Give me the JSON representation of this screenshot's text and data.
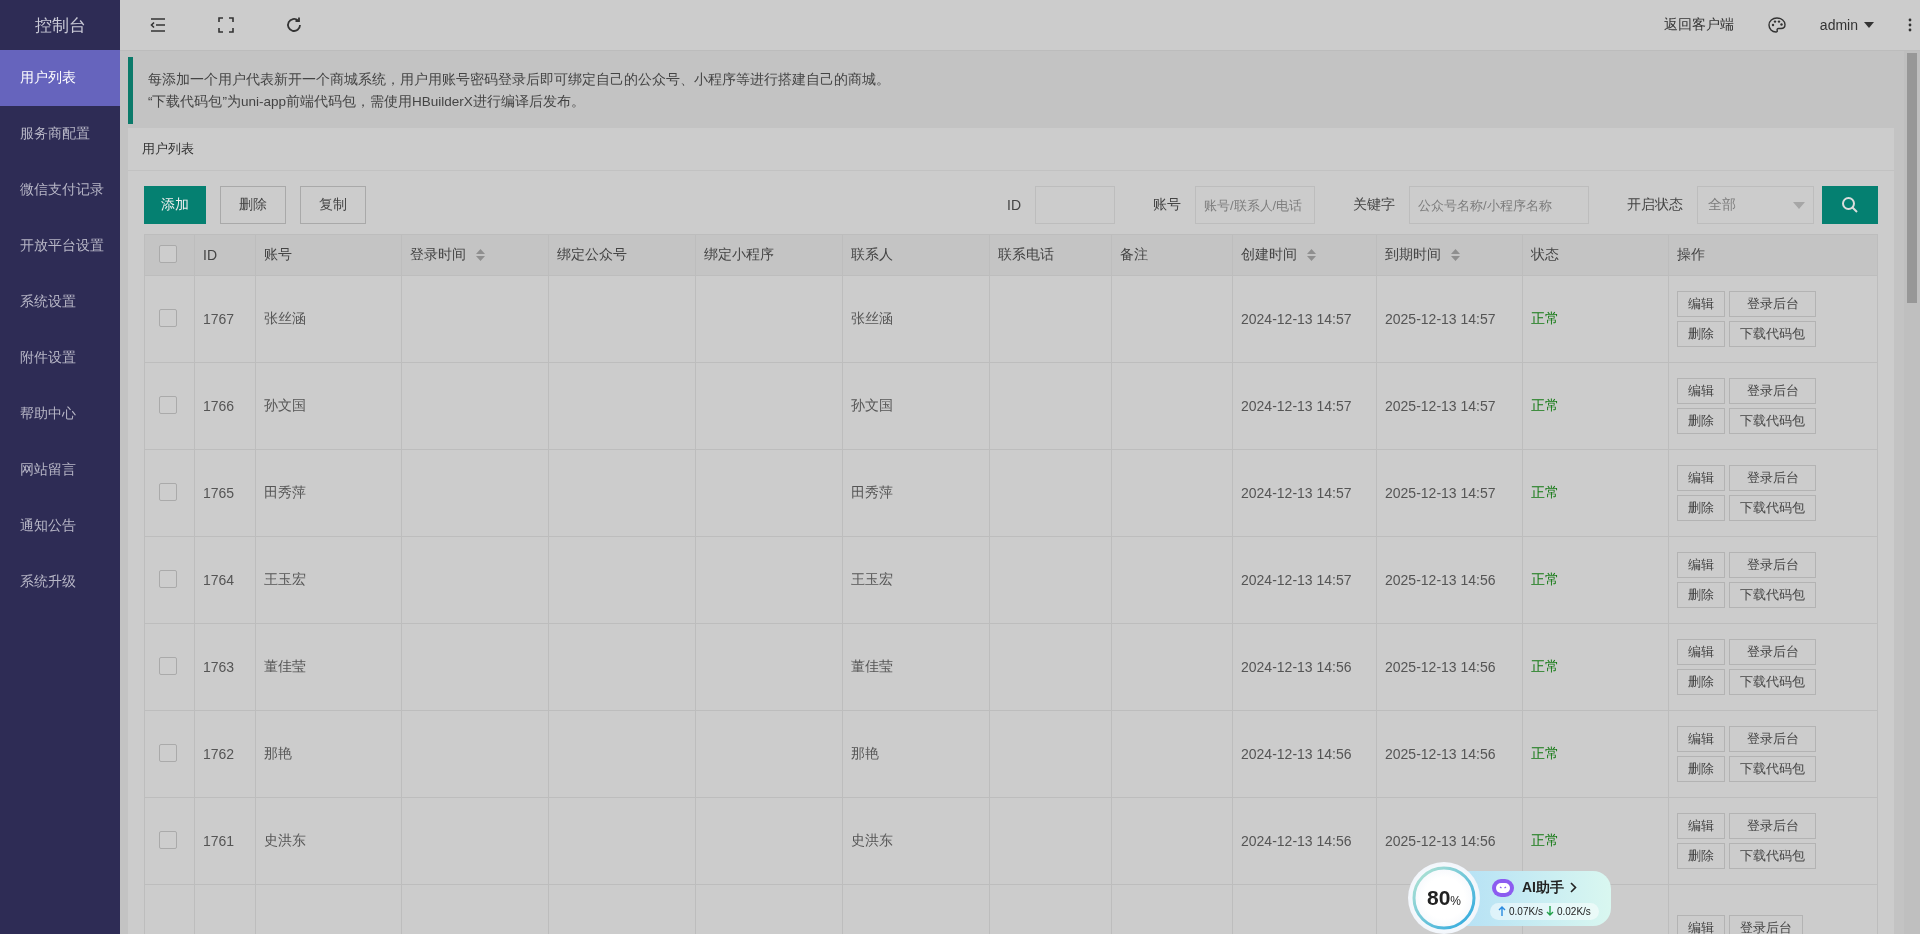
{
  "sidebar": {
    "title": "控制台",
    "items": [
      {
        "label": "用户列表",
        "selected": true
      },
      {
        "label": "服务商配置",
        "selected": false
      },
      {
        "label": "微信支付记录",
        "selected": false
      },
      {
        "label": "开放平台设置",
        "selected": false
      },
      {
        "label": "系统设置",
        "selected": false
      },
      {
        "label": "附件设置",
        "selected": false
      },
      {
        "label": "帮助中心",
        "selected": false
      },
      {
        "label": "网站留言",
        "selected": false
      },
      {
        "label": "通知公告",
        "selected": false
      },
      {
        "label": "系统升级",
        "selected": false
      }
    ]
  },
  "topbar": {
    "back_link": "返回客户端",
    "user": "admin"
  },
  "notice": [
    "每添加一个用户代表新开一个商城系统，用户用账号密码登录后即可绑定自己的公众号、小程序等进行搭建自己的商城。",
    "“下载代码包”为uni-app前端代码包，需使用HBuilderX进行编译后发布。"
  ],
  "card_title": "用户列表",
  "actions": [
    {
      "label": "添加",
      "kind": "primary"
    },
    {
      "label": "删除",
      "kind": "plain"
    },
    {
      "label": "复制",
      "kind": "plain"
    }
  ],
  "filters": [
    {
      "label": "ID",
      "kind": "input"
    },
    {
      "label": "账号",
      "kind": "input",
      "placeholder": "账号/联系人/电话"
    },
    {
      "label": "关键字",
      "kind": "input",
      "placeholder": "公众号名称/小程序名称"
    },
    {
      "label": "开启状态",
      "kind": "select",
      "value": "全部"
    }
  ],
  "table": {
    "all_checked": false,
    "columns": [
      {
        "label": "ID",
        "sortable": false
      },
      {
        "label": "账号",
        "sortable": false
      },
      {
        "label": "登录时间",
        "sortable": true
      },
      {
        "label": "绑定公众号",
        "sortable": false
      },
      {
        "label": "绑定小程序",
        "sortable": false
      },
      {
        "label": "联系人",
        "sortable": false
      },
      {
        "label": "联系电话",
        "sortable": false
      },
      {
        "label": "备注",
        "sortable": false
      },
      {
        "label": "创建时间",
        "sortable": true
      },
      {
        "label": "到期时间",
        "sortable": true
      },
      {
        "label": "状态",
        "sortable": false
      },
      {
        "label": "操作",
        "sortable": false
      }
    ],
    "rows": [
      {
        "checked": false,
        "id": "1767",
        "account": "张丝涵",
        "contact": "张丝涵",
        "created": "2024-12-13 14:57",
        "expires": "2025-12-13 14:57",
        "status": "正常",
        "buttons": [
          "编辑",
          "登录后台",
          "删除",
          "下载代码包"
        ]
      },
      {
        "checked": false,
        "id": "1766",
        "account": "孙文国",
        "contact": "孙文国",
        "created": "2024-12-13 14:57",
        "expires": "2025-12-13 14:57",
        "status": "正常",
        "buttons": [
          "编辑",
          "登录后台",
          "删除",
          "下载代码包"
        ]
      },
      {
        "checked": false,
        "id": "1765",
        "account": "田秀萍",
        "contact": "田秀萍",
        "created": "2024-12-13 14:57",
        "expires": "2025-12-13 14:57",
        "status": "正常",
        "buttons": [
          "编辑",
          "登录后台",
          "删除",
          "下载代码包"
        ]
      },
      {
        "checked": false,
        "id": "1764",
        "account": "王玉宏",
        "contact": "王玉宏",
        "created": "2024-12-13 14:57",
        "expires": "2025-12-13 14:56",
        "status": "正常",
        "buttons": [
          "编辑",
          "登录后台",
          "删除",
          "下载代码包"
        ]
      },
      {
        "checked": false,
        "id": "1763",
        "account": "董佳莹",
        "contact": "董佳莹",
        "created": "2024-12-13 14:56",
        "expires": "2025-12-13 14:56",
        "status": "正常",
        "buttons": [
          "编辑",
          "登录后台",
          "删除",
          "下载代码包"
        ]
      },
      {
        "checked": false,
        "id": "1762",
        "account": "那艳",
        "contact": "那艳",
        "created": "2024-12-13 14:56",
        "expires": "2025-12-13 14:56",
        "status": "正常",
        "buttons": [
          "编辑",
          "登录后台",
          "删除",
          "下载代码包"
        ]
      },
      {
        "checked": false,
        "id": "1761",
        "account": "史洪东",
        "contact": "史洪东",
        "created": "2024-12-13 14:56",
        "expires": "2025-12-13 14:56",
        "status": "正常",
        "buttons": [
          "编辑",
          "登录后台",
          "删除",
          "下载代码包"
        ]
      },
      {
        "buttons": [
          "编辑",
          "登录后台"
        ]
      }
    ]
  },
  "widget": {
    "gauge_value": "80",
    "gauge_unit": "%",
    "title": "AI助手",
    "upload": "0.07K/s",
    "download": "0.02K/s"
  }
}
